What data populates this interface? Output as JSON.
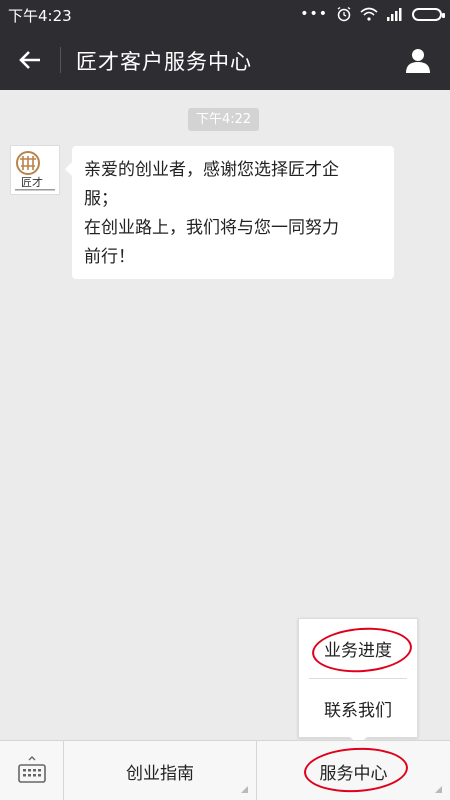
{
  "status_bar": {
    "time": "下午4:23",
    "icons": [
      "more-dots-icon",
      "alarm-icon",
      "wifi-icon",
      "signal-icon",
      "battery-icon"
    ]
  },
  "title_bar": {
    "title": "匠才客户服务中心",
    "back_icon": "arrow-left-icon",
    "profile_icon": "person-icon"
  },
  "chat": {
    "timestamp": "下午4:22",
    "message_lines": [
      "亲爱的创业者，感谢您选择匠才企",
      "服；",
      "在创业路上，我们将与您一同努力",
      "前行！"
    ],
    "avatar_logo_text": "匠才"
  },
  "popup_menu": {
    "items": [
      "业务进度",
      "联系我们"
    ]
  },
  "bottom_menu": {
    "tabs": [
      "创业指南",
      "服务中心"
    ],
    "keyboard_icon": "keyboard-icon"
  },
  "colors": {
    "bar_bg": "#2e2e32",
    "chat_bg": "#ebebeb",
    "annotation": "#e0001b"
  }
}
